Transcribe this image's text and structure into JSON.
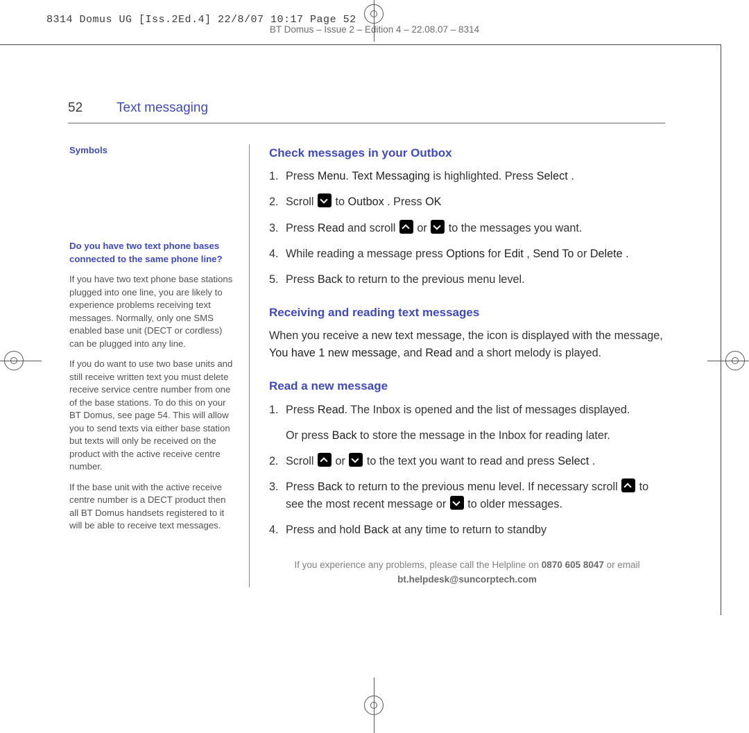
{
  "meta": {
    "print_line": "8314 Domus UG [Iss.2Ed.4]  22/8/07  10:17  Page 52",
    "subtitle": "BT Domus – Issue 2 – Edition 4 – 22.08.07 – 8314"
  },
  "header": {
    "page_number": "52",
    "title": "Text messaging"
  },
  "sidebar": {
    "symbols_heading": "Symbols",
    "question": "Do you have two text phone bases connected to the same phone line?",
    "p1": "If you have two text phone base stations plugged into one line, you are likely to experience problems receiving text messages. Normally, only one SMS enabled base unit (DECT or cordless) can be plugged into any line.",
    "p2": "If you do want to use two base units and still receive written text you must delete receive service centre number from one of the base stations. To do this on your BT Domus, see page 54. This will allow you to send texts via either base station but texts will only be received on the product with the active receive centre number.",
    "p3": "If the base unit with the active receive centre number is a DECT product then all BT Domus handsets registered to it will be able to receive text messages."
  },
  "main": {
    "h_check": "Check messages in your Outbox",
    "check": {
      "i1a": "Press ",
      "i1b": "Menu",
      "i1c": ". ",
      "i1d": "Text Messaging",
      "i1e": " is highlighted. Press ",
      "i1f": "Select",
      "i1g": " .",
      "i2a": "Scroll ",
      "i2b": " to ",
      "i2c": "Outbox",
      "i2d": " . Press ",
      "i2e": "OK",
      "i3a": "Press ",
      "i3b": "Read",
      "i3c": " and scroll ",
      "i3d": " or ",
      "i3e": " to the messages you want.",
      "i4a": "While reading a message press ",
      "i4b": "Options",
      "i4c": " for ",
      "i4d": "Edit",
      "i4e": " , ",
      "i4f": "Send To",
      "i4g": " or ",
      "i4h": "Delete",
      "i4i": " .",
      "i5a": "Press ",
      "i5b": "Back",
      "i5c": " to return to the previous menu level."
    },
    "h_recv": "Receiving and reading text messages",
    "recv_p_a": "When you receive a new text message, the       icon is displayed with the message, ",
    "recv_p_b": "You have 1 new message",
    "recv_p_c": ", and ",
    "recv_p_d": "Read",
    "recv_p_e": " and a short melody is played.",
    "h_read": "Read a new message",
    "read": {
      "i1a": "Press ",
      "i1b": "Read",
      "i1c": ". The Inbox is opened and the list of messages displayed.",
      "i1_alt_a": "Or press ",
      "i1_alt_b": "Back",
      "i1_alt_c": " to store the message in the Inbox for reading later.",
      "i2a": "Scroll ",
      "i2b": " or ",
      "i2c": " to the text you want to read and press ",
      "i2d": "Select",
      "i2e": " .",
      "i3a": "Press ",
      "i3b": "Back",
      "i3c": " to return to the previous menu level. If necessary scroll ",
      "i3d": " to see the most recent message or ",
      "i3e": " to older messages.",
      "i4a": "Press and hold ",
      "i4b": "Back",
      "i4c": " at any time to return to standby"
    }
  },
  "footer": {
    "a": "If you experience any problems, please call the Helpline on ",
    "phone": "0870 605 8047",
    "b": " or email ",
    "email": "bt.helpdesk@suncorptech.com"
  }
}
